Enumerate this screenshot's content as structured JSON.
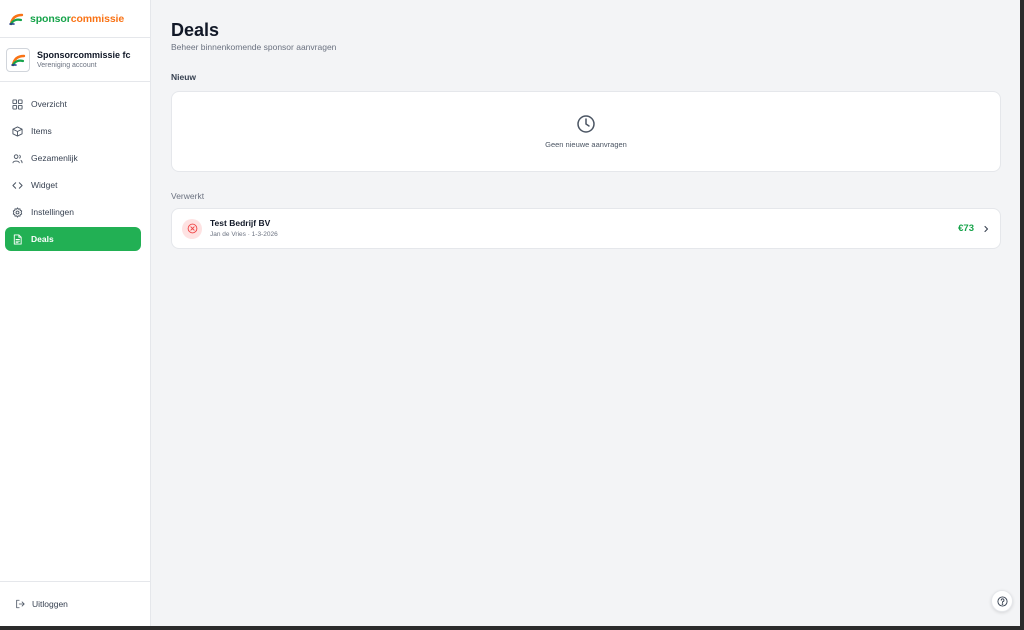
{
  "brand": {
    "part1": "sponsor",
    "part2": "commissie",
    "green": "#16a34a",
    "orange": "#f97316"
  },
  "account": {
    "name": "Sponsorcommissie fc",
    "type": "Vereniging account"
  },
  "nav": {
    "items": [
      {
        "label": "Overzicht",
        "icon": "grid-icon"
      },
      {
        "label": "Items",
        "icon": "box-icon"
      },
      {
        "label": "Gezamenlijk",
        "icon": "users-icon"
      },
      {
        "label": "Widget",
        "icon": "code-icon"
      },
      {
        "label": "Instellingen",
        "icon": "gear-icon"
      },
      {
        "label": "Deals",
        "icon": "document-icon",
        "active": true
      }
    ],
    "active_color": "#22b054"
  },
  "logout": {
    "label": "Uitloggen",
    "icon": "logout-icon"
  },
  "page": {
    "title": "Deals",
    "subtitle": "Beheer binnenkomende sponsor aanvragen"
  },
  "sections": {
    "new": {
      "title": "Nieuw",
      "empty_text": "Geen nieuwe aanvragen",
      "empty_icon": "clock-icon"
    },
    "processed": {
      "title": "Verwerkt",
      "deals": [
        {
          "name": "Test Bedrijf BV",
          "meta": "Jan de Vries · 1-3-2026",
          "amount": "€73",
          "status_icon": "x-circle-icon",
          "status_color": "#ef4444"
        }
      ]
    }
  },
  "help": {
    "icon": "help-icon"
  }
}
